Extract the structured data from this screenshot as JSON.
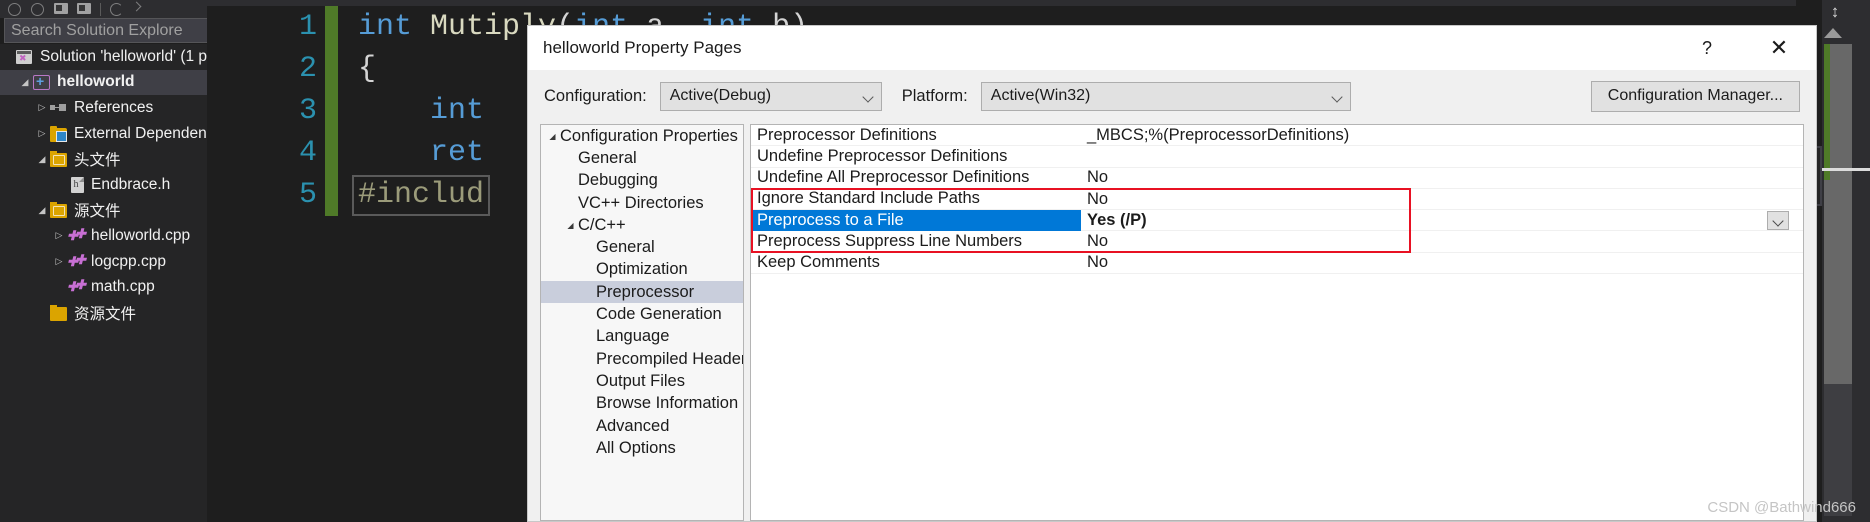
{
  "ide": {
    "toolbar_icons": [
      "back-circle-icon",
      "forward-circle-icon",
      "home-icon",
      "properties-window-icon",
      "toolbar-separator",
      "refresh-icon",
      "collapse-all-icon"
    ],
    "search": {
      "placeholder": "Search Solution Explore",
      "value": "",
      "key_icon": "search-key-icon",
      "dropdown_icon": "chevron-down-icon"
    },
    "solution_tree": [
      {
        "label": "Solution 'helloworld' (1 p",
        "icon": "solution-icon",
        "indent": 0,
        "expander": "",
        "bold": false,
        "selected": false
      },
      {
        "label": "helloworld",
        "icon": "project-icon",
        "indent": 1,
        "expander": "◢",
        "bold": true,
        "selected": true
      },
      {
        "label": "References",
        "icon": "references-icon",
        "indent": 2,
        "expander": "▷",
        "bold": false,
        "selected": false
      },
      {
        "label": "External Dependen",
        "icon": "external-dependencies-icon",
        "indent": 2,
        "expander": "▷",
        "bold": false,
        "selected": false
      },
      {
        "label": "头文件",
        "icon": "filter-folder-icon",
        "indent": 2,
        "expander": "◢",
        "bold": false,
        "selected": false
      },
      {
        "label": "Endbrace.h",
        "icon": "header-file-icon",
        "indent": 3,
        "expander": "",
        "bold": false,
        "selected": false
      },
      {
        "label": "源文件",
        "icon": "filter-folder-icon",
        "indent": 2,
        "expander": "◢",
        "bold": false,
        "selected": false
      },
      {
        "label": "helloworld.cpp",
        "icon": "cpp-file-icon",
        "indent": 3,
        "expander": "▷",
        "bold": false,
        "selected": false
      },
      {
        "label": "logcpp.cpp",
        "icon": "cpp-file-icon",
        "indent": 3,
        "expander": "▷",
        "bold": false,
        "selected": false
      },
      {
        "label": "math.cpp",
        "icon": "cpp-file-icon",
        "indent": 3,
        "expander": "",
        "bold": false,
        "selected": false
      },
      {
        "label": "资源文件",
        "icon": "folder-icon",
        "indent": 2,
        "expander": "",
        "bold": false,
        "selected": false
      }
    ],
    "editor": {
      "lines": [
        {
          "num": "1",
          "text": "int Mutiply(int a, int b)",
          "boxed": false
        },
        {
          "num": "2",
          "text": "{",
          "boxed": false
        },
        {
          "num": "3",
          "text": "    int",
          "boxed": false
        },
        {
          "num": "4",
          "text": "    ret",
          "boxed": false
        },
        {
          "num": "5",
          "text": "#includ",
          "boxed": true
        }
      ]
    }
  },
  "dialog": {
    "title": "helloworld Property Pages",
    "help_label": "?",
    "close_label": "✕",
    "configuration_label": "Configuration:",
    "configuration_value": "Active(Debug)",
    "platform_label": "Platform:",
    "platform_value": "Active(Win32)",
    "configuration_manager_label": "Configuration Manager...",
    "tree": [
      {
        "label": "Configuration Properties",
        "indent": 0,
        "expander": "◢",
        "selected": false
      },
      {
        "label": "General",
        "indent": 1,
        "expander": "",
        "selected": false
      },
      {
        "label": "Debugging",
        "indent": 1,
        "expander": "",
        "selected": false
      },
      {
        "label": "VC++ Directories",
        "indent": 1,
        "expander": "",
        "selected": false
      },
      {
        "label": "C/C++",
        "indent": 1,
        "expander": "◢",
        "selected": false
      },
      {
        "label": "General",
        "indent": 2,
        "expander": "",
        "selected": false
      },
      {
        "label": "Optimization",
        "indent": 2,
        "expander": "",
        "selected": false
      },
      {
        "label": "Preprocessor",
        "indent": 2,
        "expander": "",
        "selected": true
      },
      {
        "label": "Code Generation",
        "indent": 2,
        "expander": "",
        "selected": false
      },
      {
        "label": "Language",
        "indent": 2,
        "expander": "",
        "selected": false
      },
      {
        "label": "Precompiled Header",
        "indent": 2,
        "expander": "",
        "selected": false
      },
      {
        "label": "Output Files",
        "indent": 2,
        "expander": "",
        "selected": false
      },
      {
        "label": "Browse Information",
        "indent": 2,
        "expander": "",
        "selected": false
      },
      {
        "label": "Advanced",
        "indent": 2,
        "expander": "",
        "selected": false
      },
      {
        "label": "All Options",
        "indent": 2,
        "expander": "",
        "selected": false
      }
    ],
    "properties": [
      {
        "name": "Preprocessor Definitions",
        "value": "_MBCS;%(PreprocessorDefinitions)",
        "selected": false,
        "bold": false,
        "dropdown": false
      },
      {
        "name": "Undefine Preprocessor Definitions",
        "value": "",
        "selected": false,
        "bold": false,
        "dropdown": false
      },
      {
        "name": "Undefine All Preprocessor Definitions",
        "value": "No",
        "selected": false,
        "bold": false,
        "dropdown": false
      },
      {
        "name": "Ignore Standard Include Paths",
        "value": "No",
        "selected": false,
        "bold": false,
        "dropdown": false
      },
      {
        "name": "Preprocess to a File",
        "value": "Yes (/P)",
        "selected": true,
        "bold": true,
        "dropdown": true
      },
      {
        "name": "Preprocess Suppress Line Numbers",
        "value": "No",
        "selected": false,
        "bold": false,
        "dropdown": false
      },
      {
        "name": "Keep Comments",
        "value": "No",
        "selected": false,
        "bold": false,
        "dropdown": false
      }
    ],
    "highlight_color": "#e81123",
    "selection_color": "#0078d7"
  },
  "watermark": "CSDN @Bathwind666"
}
